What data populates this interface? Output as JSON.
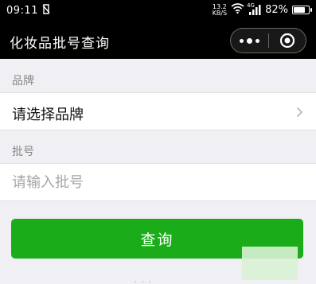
{
  "status_bar": {
    "time": "09:11",
    "network_speed_value": "13.2",
    "network_speed_unit": "KB/S",
    "network_type": "4G",
    "battery_percent": "82%",
    "battery_level": 0.82
  },
  "nav": {
    "title": "化妆品批号查询",
    "menu_icon": "more-dots-icon",
    "close_icon": "target-circle-icon"
  },
  "form": {
    "brand_label": "品牌",
    "brand_value": "请选择品牌",
    "batch_label": "批号",
    "batch_placeholder": "请输入批号",
    "submit_label": "查询"
  },
  "colors": {
    "nav_background": "#000000",
    "button_green": "#1aad19",
    "page_background": "#efeff4"
  }
}
